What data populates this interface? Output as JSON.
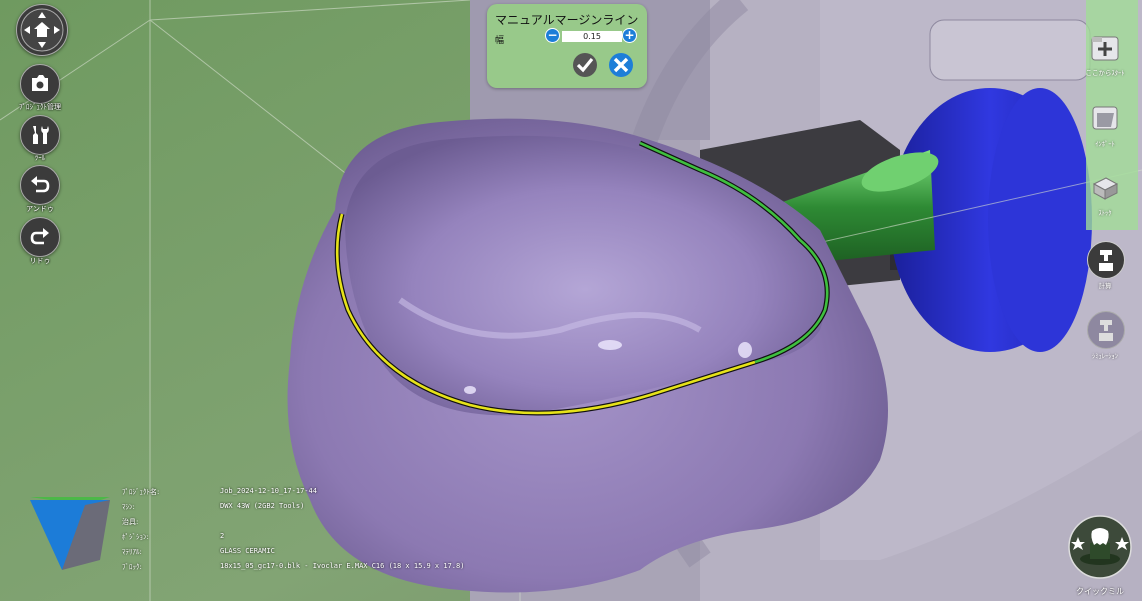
{
  "colors": {
    "accent_blue": "#1d7ed8",
    "panel_green": "#98c98a",
    "margin_line_yellow": "#e6e21a",
    "margin_line_green": "#3fbf3f",
    "model_purple": "#8e7bb2",
    "tool_blue": "#2b34d6"
  },
  "left_toolbar": {
    "home_icon": "home-dpad-icon",
    "project_manager_label": "ﾌﾟﾛｼﾞｪｸﾄ管理",
    "tool_label": "ﾂｰﾙ",
    "undo_label": "アンドゥ",
    "redo_label": "リドゥ"
  },
  "margin_panel": {
    "title": "マニュアルマージンライン",
    "width_label": "幅",
    "width_value": "0.15",
    "decrement": "−",
    "increment": "+"
  },
  "right_toolbar": {
    "items": [
      {
        "label": "ここからｽﾀｰﾄ",
        "icon": "add-start-icon"
      },
      {
        "label": "ｲﾝﾎﾟｰﾄ",
        "icon": "import-icon"
      },
      {
        "label": "ｽﾄｯｸ",
        "icon": "stock-icon"
      },
      {
        "label": "計算",
        "icon": "calculate-icon"
      },
      {
        "label": "ｼﾐｭﾚｰｼｮﾝ",
        "icon": "simulation-icon"
      }
    ]
  },
  "info": {
    "rows": [
      {
        "label": "ﾌﾟﾛｼﾞｪｸﾄ名:",
        "value": "Job_2024-12-10_17-17-44"
      },
      {
        "label": "ﾏｼﾝ:",
        "value": "DWX 43W (2GB2 Tools)"
      },
      {
        "label": "治具:",
        "value": ""
      },
      {
        "label": "ﾎﾟｼﾞｼｮﾝ:",
        "value": "2"
      },
      {
        "label": "ﾏﾃﾘｱﾙ:",
        "value": "GLASS CERAMIC"
      },
      {
        "label": "ﾌﾞﾛｯｸ:",
        "value": "18x15_05_gc17-0.blk - Ivoclar E.MAX C16 (18 x 15.9 x 17.8)"
      }
    ]
  },
  "quick_mill": {
    "label": "クイックミル"
  }
}
